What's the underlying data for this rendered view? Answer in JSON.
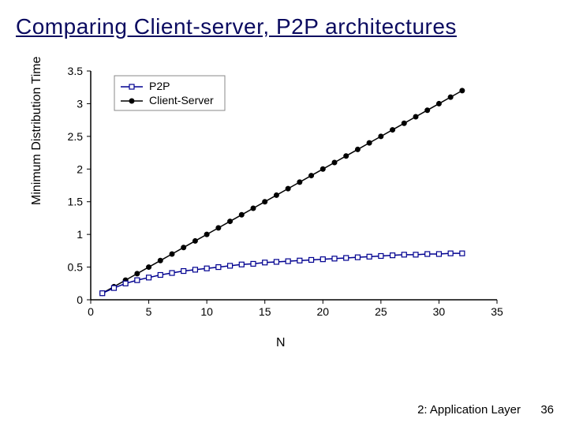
{
  "title": "Comparing Client-server, P2P architectures",
  "footer": {
    "section": "2: Application Layer",
    "page": "36"
  },
  "chart_data": {
    "type": "line",
    "xlabel": "N",
    "ylabel": "Minimum Distribution Time",
    "xlim": [
      0,
      35
    ],
    "ylim": [
      0,
      3.5
    ],
    "xticks": [
      0,
      5,
      10,
      15,
      20,
      25,
      30,
      35
    ],
    "yticks": [
      0,
      0.5,
      1,
      1.5,
      2,
      2.5,
      3,
      3.5
    ],
    "legend": {
      "p2p": "P2P",
      "cs": "Client-Server"
    },
    "x": [
      1,
      2,
      3,
      4,
      5,
      6,
      7,
      8,
      9,
      10,
      11,
      12,
      13,
      14,
      15,
      16,
      17,
      18,
      19,
      20,
      21,
      22,
      23,
      24,
      25,
      26,
      27,
      28,
      29,
      30,
      31,
      32
    ],
    "series": [
      {
        "name": "Client-Server",
        "key": "cs",
        "values": [
          0.1,
          0.2,
          0.3,
          0.4,
          0.5,
          0.6,
          0.7,
          0.8,
          0.9,
          1.0,
          1.1,
          1.2,
          1.3,
          1.4,
          1.5,
          1.6,
          1.7,
          1.8,
          1.9,
          2.0,
          2.1,
          2.2,
          2.3,
          2.4,
          2.5,
          2.6,
          2.7,
          2.8,
          2.9,
          3.0,
          3.1,
          3.2
        ]
      },
      {
        "name": "P2P",
        "key": "p2p",
        "values": [
          0.1,
          0.18,
          0.25,
          0.3,
          0.34,
          0.38,
          0.41,
          0.44,
          0.46,
          0.48,
          0.5,
          0.52,
          0.54,
          0.55,
          0.57,
          0.58,
          0.59,
          0.6,
          0.61,
          0.62,
          0.63,
          0.64,
          0.65,
          0.66,
          0.67,
          0.68,
          0.69,
          0.69,
          0.7,
          0.7,
          0.71,
          0.71
        ]
      }
    ]
  }
}
